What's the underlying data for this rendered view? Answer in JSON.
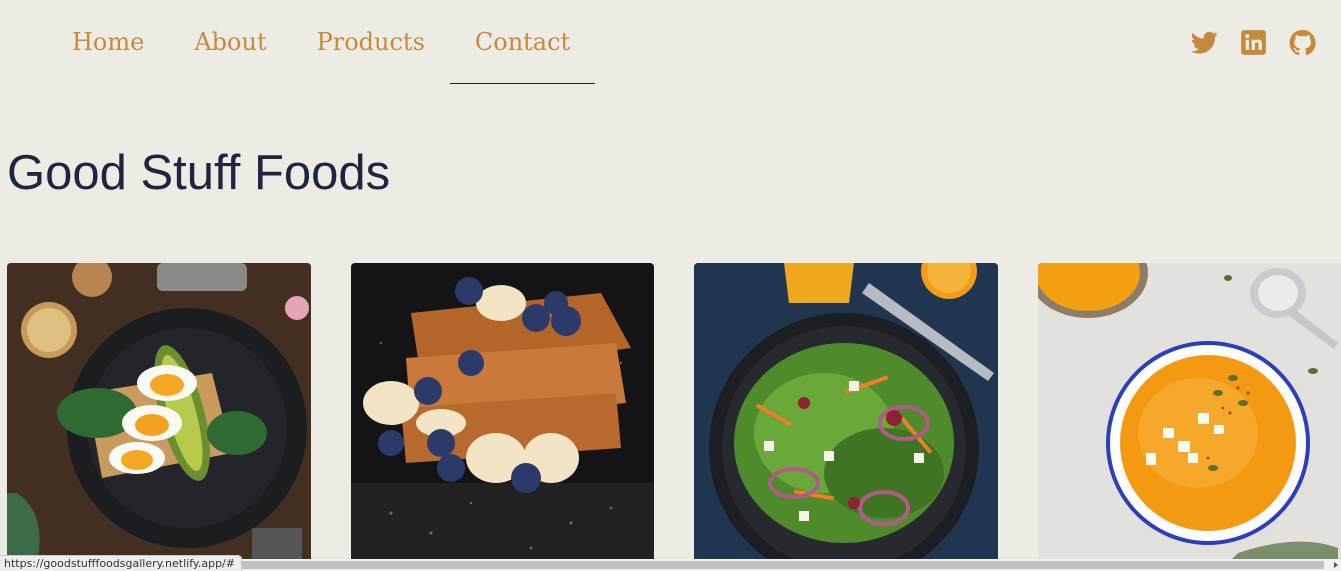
{
  "nav": {
    "items": [
      {
        "label": "Home"
      },
      {
        "label": "About"
      },
      {
        "label": "Products"
      },
      {
        "label": "Contact"
      }
    ],
    "active": "Contact"
  },
  "social": {
    "icons": [
      "twitter-icon",
      "linkedin-icon",
      "github-icon"
    ],
    "color": "#c58b3c"
  },
  "page_title": "Good Stuff Foods",
  "gallery": {
    "items": [
      {
        "subject": "avocado-egg-toast"
      },
      {
        "subject": "french-toast-blueberries"
      },
      {
        "subject": "green-salad"
      },
      {
        "subject": "pumpkin-soup"
      }
    ]
  },
  "status_bar": {
    "url": "https://goodstufffoodsgallery.netlify.app/#"
  },
  "colors": {
    "background": "#ecece5",
    "accent": "#c58b3c",
    "title": "#1f2540"
  }
}
